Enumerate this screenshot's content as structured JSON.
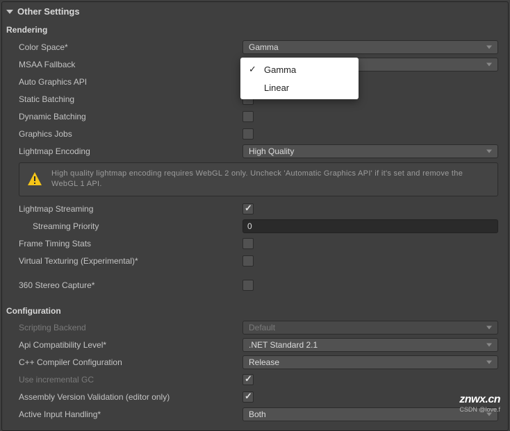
{
  "header": {
    "title": "Other Settings"
  },
  "rendering": {
    "heading": "Rendering",
    "colorSpace": {
      "label": "Color Space*",
      "value": "Gamma"
    },
    "msaaFallback": {
      "label": "MSAA Fallback",
      "value": ""
    },
    "autoGraphicsApi": {
      "label": "Auto Graphics API"
    },
    "staticBatching": {
      "label": "Static Batching"
    },
    "dynamicBatching": {
      "label": "Dynamic Batching"
    },
    "graphicsJobs": {
      "label": "Graphics Jobs"
    },
    "lightmapEncoding": {
      "label": "Lightmap Encoding",
      "value": "High Quality"
    },
    "warning": "High quality lightmap encoding requires WebGL 2 only. Uncheck 'Automatic Graphics API' if it's set and remove the WebGL 1 API.",
    "lightmapStreaming": {
      "label": "Lightmap Streaming"
    },
    "streamingPriority": {
      "label": "Streaming Priority",
      "value": "0"
    },
    "frameTimingStats": {
      "label": "Frame Timing Stats"
    },
    "virtualTexturing": {
      "label": "Virtual Texturing (Experimental)*"
    },
    "stereoCapture": {
      "label": "360 Stereo Capture*"
    }
  },
  "configuration": {
    "heading": "Configuration",
    "scriptingBackend": {
      "label": "Scripting Backend",
      "value": "Default"
    },
    "apiCompat": {
      "label": "Api Compatibility Level*",
      "value": ".NET Standard 2.1"
    },
    "cppCompiler": {
      "label": "C++ Compiler Configuration",
      "value": "Release"
    },
    "incrementalGC": {
      "label": "Use incremental GC"
    },
    "assemblyValidation": {
      "label": "Assembly Version Validation (editor only)"
    },
    "activeInput": {
      "label": "Active Input Handling*",
      "value": "Both"
    }
  },
  "popup": {
    "items": [
      {
        "label": "Gamma",
        "checked": true
      },
      {
        "label": "Linear",
        "checked": false
      }
    ]
  },
  "watermark": {
    "main": "znwx.cn",
    "sub": "CSDN @love.f"
  }
}
